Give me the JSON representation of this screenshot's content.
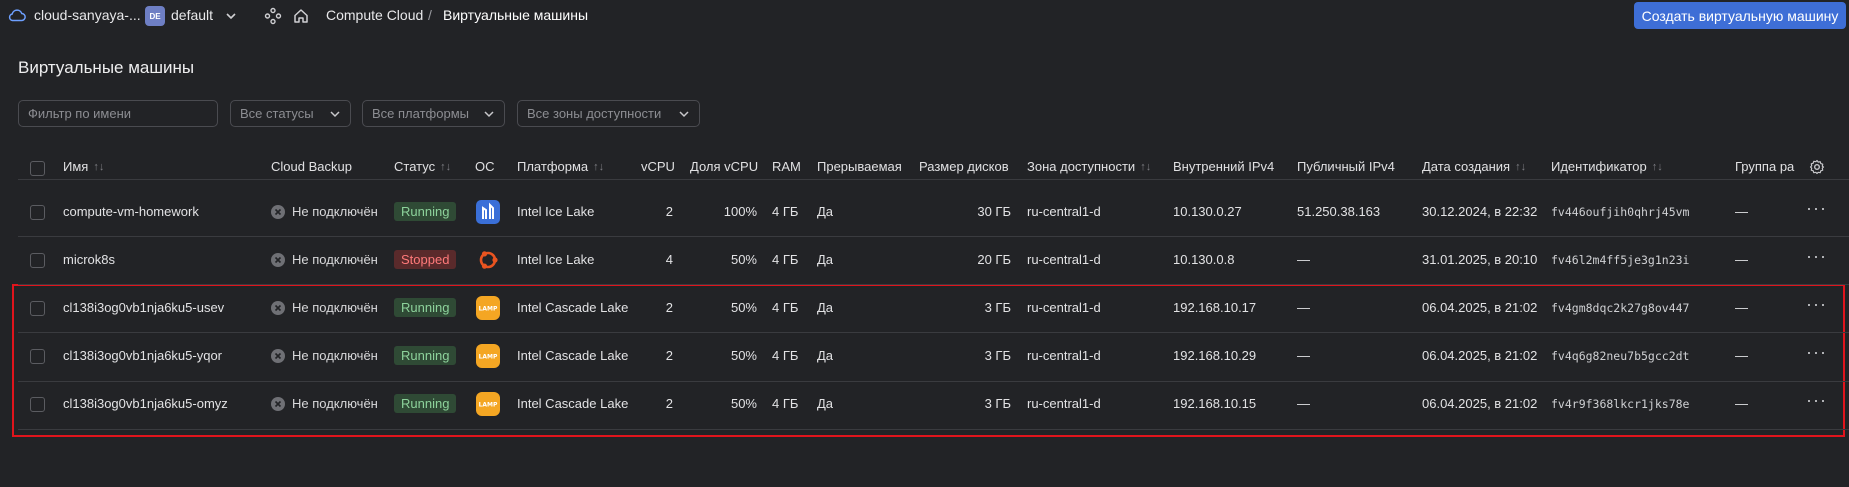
{
  "header": {
    "cloud_name": "cloud-sanyaya-...",
    "folder_badge": "DE",
    "folder_name": "default",
    "breadcrumb_service": "Compute Cloud",
    "breadcrumb_sep": "/",
    "breadcrumb_page": "Виртуальные машины",
    "create_button": "Создать виртуальную машину"
  },
  "page_title": "Виртуальные машины",
  "filters": {
    "name_placeholder": "Фильтр по имени",
    "status": "Все статусы",
    "platform": "Все платформы",
    "zone": "Все зоны доступности"
  },
  "columns": {
    "name": "Имя",
    "backup": "Cloud Backup",
    "status": "Статус",
    "os": "ОС",
    "platform": "Платформа",
    "vcpu": "vCPU",
    "vcpu_share": "Доля vCPU",
    "ram": "RAM",
    "preemptible": "Прерываемая",
    "disk": "Размер дисков",
    "zone": "Зона доступности",
    "ipv4_int": "Внутренний IPv4",
    "ipv4_pub": "Публичный IPv4",
    "created": "Дата создания",
    "id": "Идентификатор",
    "group": "Группа ра"
  },
  "rows": [
    {
      "name": "compute-vm-homework",
      "backup": "Не подключён",
      "status": "Running",
      "os": "debian-icon",
      "platform": "Intel Ice Lake",
      "vcpu": "2",
      "vcpu_share": "100%",
      "ram": "4 ГБ",
      "preemptible": "Да",
      "disk": "30 ГБ",
      "zone": "ru-central1-d",
      "ipv4_int": "10.130.0.27",
      "ipv4_pub": "51.250.38.163",
      "created": "30.12.2024, в 22:32",
      "id": "fv446oufjih0qhrj45vm",
      "group": "—"
    },
    {
      "name": "microk8s",
      "backup": "Не подключён",
      "status": "Stopped",
      "os": "ubuntu-icon",
      "platform": "Intel Ice Lake",
      "vcpu": "4",
      "vcpu_share": "50%",
      "ram": "4 ГБ",
      "preemptible": "Да",
      "disk": "20 ГБ",
      "zone": "ru-central1-d",
      "ipv4_int": "10.130.0.8",
      "ipv4_pub": "—",
      "created": "31.01.2025, в 20:10",
      "id": "fv46l2m4ff5je3g1n23i",
      "group": "—"
    },
    {
      "name": "cl138i3og0vb1nja6ku5-usev",
      "backup": "Не подключён",
      "status": "Running",
      "os": "lamp-icon",
      "platform": "Intel Cascade Lake",
      "vcpu": "2",
      "vcpu_share": "50%",
      "ram": "4 ГБ",
      "preemptible": "Да",
      "disk": "3 ГБ",
      "zone": "ru-central1-d",
      "ipv4_int": "192.168.10.17",
      "ipv4_pub": "—",
      "created": "06.04.2025, в 21:02",
      "id": "fv4gm8dqc2k27g8ov447",
      "group": "—"
    },
    {
      "name": "cl138i3og0vb1nja6ku5-yqor",
      "backup": "Не подключён",
      "status": "Running",
      "os": "lamp-icon",
      "platform": "Intel Cascade Lake",
      "vcpu": "2",
      "vcpu_share": "50%",
      "ram": "4 ГБ",
      "preemptible": "Да",
      "disk": "3 ГБ",
      "zone": "ru-central1-d",
      "ipv4_int": "192.168.10.29",
      "ipv4_pub": "—",
      "created": "06.04.2025, в 21:02",
      "id": "fv4q6g82neu7b5gcc2dt",
      "group": "—"
    },
    {
      "name": "cl138i3og0vb1nja6ku5-omyz",
      "backup": "Не подключён",
      "status": "Running",
      "os": "lamp-icon",
      "platform": "Intel Cascade Lake",
      "vcpu": "2",
      "vcpu_share": "50%",
      "ram": "4 ГБ",
      "preemptible": "Да",
      "disk": "3 ГБ",
      "zone": "ru-central1-d",
      "ipv4_int": "192.168.10.15",
      "ipv4_pub": "—",
      "created": "06.04.2025, в 21:02",
      "id": "fv4r9f368lkcr1jks78e",
      "group": "—"
    }
  ],
  "lamp_label": "LAMP",
  "more_label": "···",
  "colors": {
    "background": "#222326",
    "accent": "#3e6ed6",
    "running": "#8dd29b",
    "stopped": "#ff7a7a",
    "highlight": "#e0141c"
  }
}
